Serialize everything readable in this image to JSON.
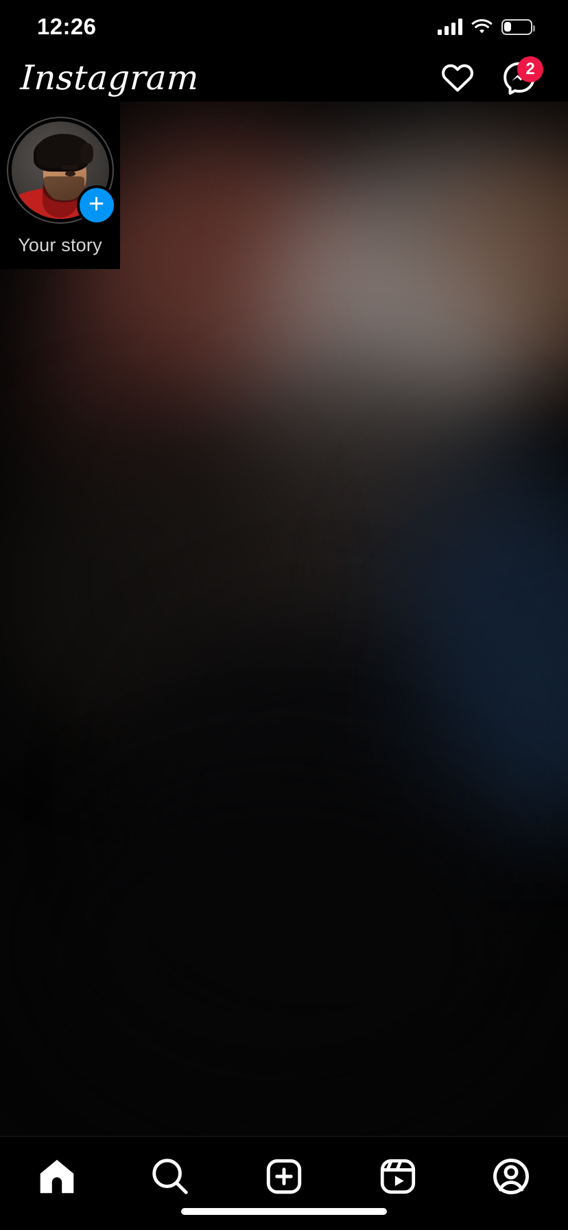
{
  "status_bar": {
    "time": "12:26",
    "signal_icon": "cellular-signal-icon",
    "signal_bars": 4,
    "wifi_icon": "wifi-icon",
    "battery_icon": "battery-low-icon",
    "battery_level_percent": 24
  },
  "header": {
    "logo_text": "Instagram",
    "actions": [
      {
        "name": "activity-heart-icon",
        "label": "Notifications",
        "badge": null
      },
      {
        "name": "messenger-icon",
        "label": "Messages",
        "badge": "2"
      }
    ],
    "badge_color": "#ED1846"
  },
  "stories": {
    "items": [
      {
        "label": "Your story",
        "has_add_badge": true,
        "add_badge_color": "#0095F6",
        "ring_color": "#4a4a4a"
      }
    ]
  },
  "feed": {
    "content": "blurred-photo-placeholder"
  },
  "tab_bar": {
    "items": [
      {
        "name": "tab-home",
        "label": "Home",
        "icon": "home-icon",
        "active": true
      },
      {
        "name": "tab-search",
        "label": "Search",
        "icon": "search-icon",
        "active": false
      },
      {
        "name": "tab-create",
        "label": "Create",
        "icon": "plus-square-icon",
        "active": false
      },
      {
        "name": "tab-reels",
        "label": "Reels",
        "icon": "reels-icon",
        "active": false
      },
      {
        "name": "tab-profile",
        "label": "Profile",
        "icon": "profile-icon",
        "active": false
      }
    ]
  },
  "system": {
    "home_indicator": "home-indicator"
  },
  "colors": {
    "background": "#000000",
    "accent_blue": "#0095F6",
    "badge_red": "#ED1846",
    "text_primary": "#FFFFFF",
    "text_secondary": "#D6D6D6"
  }
}
